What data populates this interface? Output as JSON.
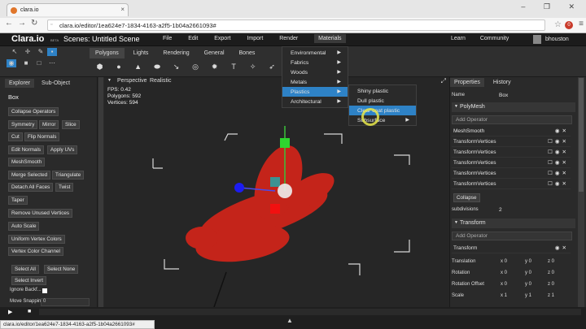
{
  "browser": {
    "tab_title": "clara.io",
    "url": "clara.io/editor/1ea624e7-1834-4163-a2f5-1b04a2661093#",
    "window_controls": "–  ❐  ✕"
  },
  "header": {
    "logo": "Clara.io",
    "beta": "BETA",
    "scene_title": "Scenes:  Untitled Scene",
    "menus": [
      "File",
      "Edit",
      "Export",
      "Import",
      "Render",
      "Materials"
    ],
    "right_links": [
      "Learn",
      "Community"
    ],
    "user": "bhouston"
  },
  "toolbar": {
    "mode_tabs": [
      "Polygons",
      "Lights",
      "Rendering",
      "General",
      "Bones"
    ],
    "icons": [
      "arrow-icon",
      "move-icon",
      "rotate-icon",
      "scale-icon",
      "select-icon",
      "cube-icon",
      "square-icon",
      "grid-icon"
    ]
  },
  "left_panel": {
    "tabs": [
      "Explorer",
      "Sub-Object"
    ],
    "object_name": "Box",
    "buttons": [
      "Collapse Operators",
      "Symmetry",
      "Mirror",
      "Slice",
      "Cut",
      "Flip Normals",
      "Edit Normals",
      "Apply UVs",
      "MeshSmooth",
      "Merge Selected",
      "Triangulate",
      "Detach All Faces",
      "Twist",
      "Taper",
      "Remove Unused Vertices",
      "Auto Scale",
      "Uniform Vertex Colors",
      "Vertex Color Channel",
      "Select All",
      "Select None",
      "Select Invert"
    ],
    "ignore_label": "Ignore Backf...",
    "move_snapping_label": "Move Snapping",
    "move_snapping_value": "0"
  },
  "viewport": {
    "camera": "Perspective",
    "shading": "Realistic",
    "fps": "FPS: 0.42",
    "polygons": "Polygons: 592",
    "vertices": "Vertices: 594",
    "mesh_color": "#c4241a"
  },
  "materials_menu": {
    "items": [
      "Environmental",
      "Fabrics",
      "Woods",
      "Metals",
      "Plastics",
      "Architectural"
    ],
    "highlighted": "Plastics",
    "submenu": [
      "Shiny plastic",
      "Dull plastic",
      "Clear coat plastic",
      "Subsurface"
    ]
  },
  "right_panel": {
    "tabs": [
      "Properties",
      "History"
    ],
    "name_label": "Name",
    "name_value": "Box",
    "section_polymesh": "PolyMesh",
    "add_operator_placeholder": "Add Operator",
    "operators": [
      "MeshSmooth",
      "TransformVertices",
      "TransformVertices",
      "TransformVertices",
      "TransformVertices",
      "TransformVertices"
    ],
    "collapse": "Collapse",
    "subdivisions_label": "subdivisions",
    "subdivisions_value": "2",
    "section_transform": "Transform",
    "transform_row": "Transform",
    "rows": [
      {
        "label": "Translation",
        "x": "x 0",
        "y": "y 0",
        "z": "z 0"
      },
      {
        "label": "Rotation",
        "x": "x 0",
        "y": "y 0",
        "z": "z 0"
      },
      {
        "label": "Rotation Offset",
        "x": "x 0",
        "y": "y 0",
        "z": "z 0"
      },
      {
        "label": "Scale",
        "x": "x 1",
        "y": "y 1",
        "z": "z 1"
      }
    ]
  },
  "status_url": "clara.io/editor/1ea624e7-1834-4163-a2f5-1b04a2661093#",
  "accent": "#2e82c6"
}
